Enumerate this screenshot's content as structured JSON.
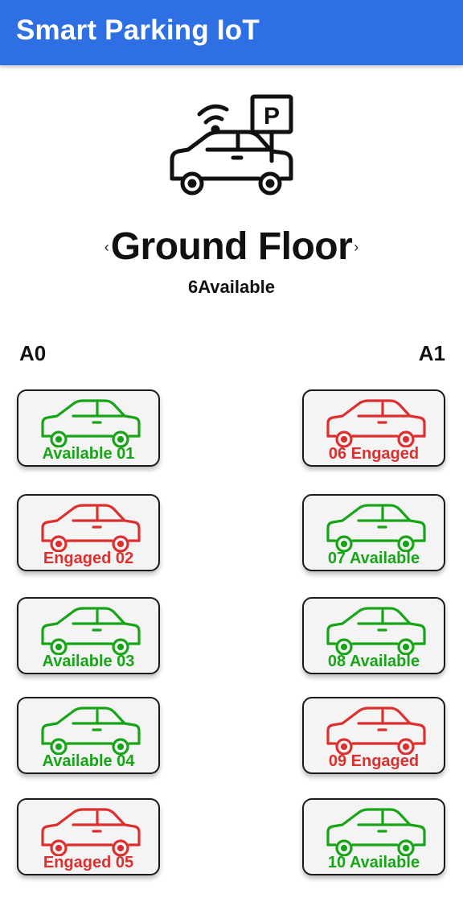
{
  "app": {
    "title": "Smart Parking IoT"
  },
  "floor": {
    "name": "Ground Floor",
    "prev_glyph": "‹",
    "next_glyph": "›",
    "available_count": "6",
    "available_suffix": "Available"
  },
  "zones": {
    "left": "A0",
    "right": "A1"
  },
  "colors": {
    "available": "#17a417",
    "engaged": "#de2f2f",
    "appbar": "#2f6fe4"
  },
  "slots_left": [
    {
      "label": "Available 01",
      "status": "available"
    },
    {
      "label": "Engaged 02",
      "status": "engaged"
    },
    {
      "label": "Available 03",
      "status": "available"
    },
    {
      "label": "Available 04",
      "status": "available"
    },
    {
      "label": "Engaged 05",
      "status": "engaged"
    }
  ],
  "slots_right": [
    {
      "label": "06 Engaged",
      "status": "engaged"
    },
    {
      "label": "07 Available",
      "status": "available"
    },
    {
      "label": "08 Available",
      "status": "available"
    },
    {
      "label": "09 Engaged",
      "status": "engaged"
    },
    {
      "label": "10 Available",
      "status": "available"
    }
  ],
  "icons": {
    "hero": "smart-parking-car-icon",
    "slot": "car-icon"
  }
}
